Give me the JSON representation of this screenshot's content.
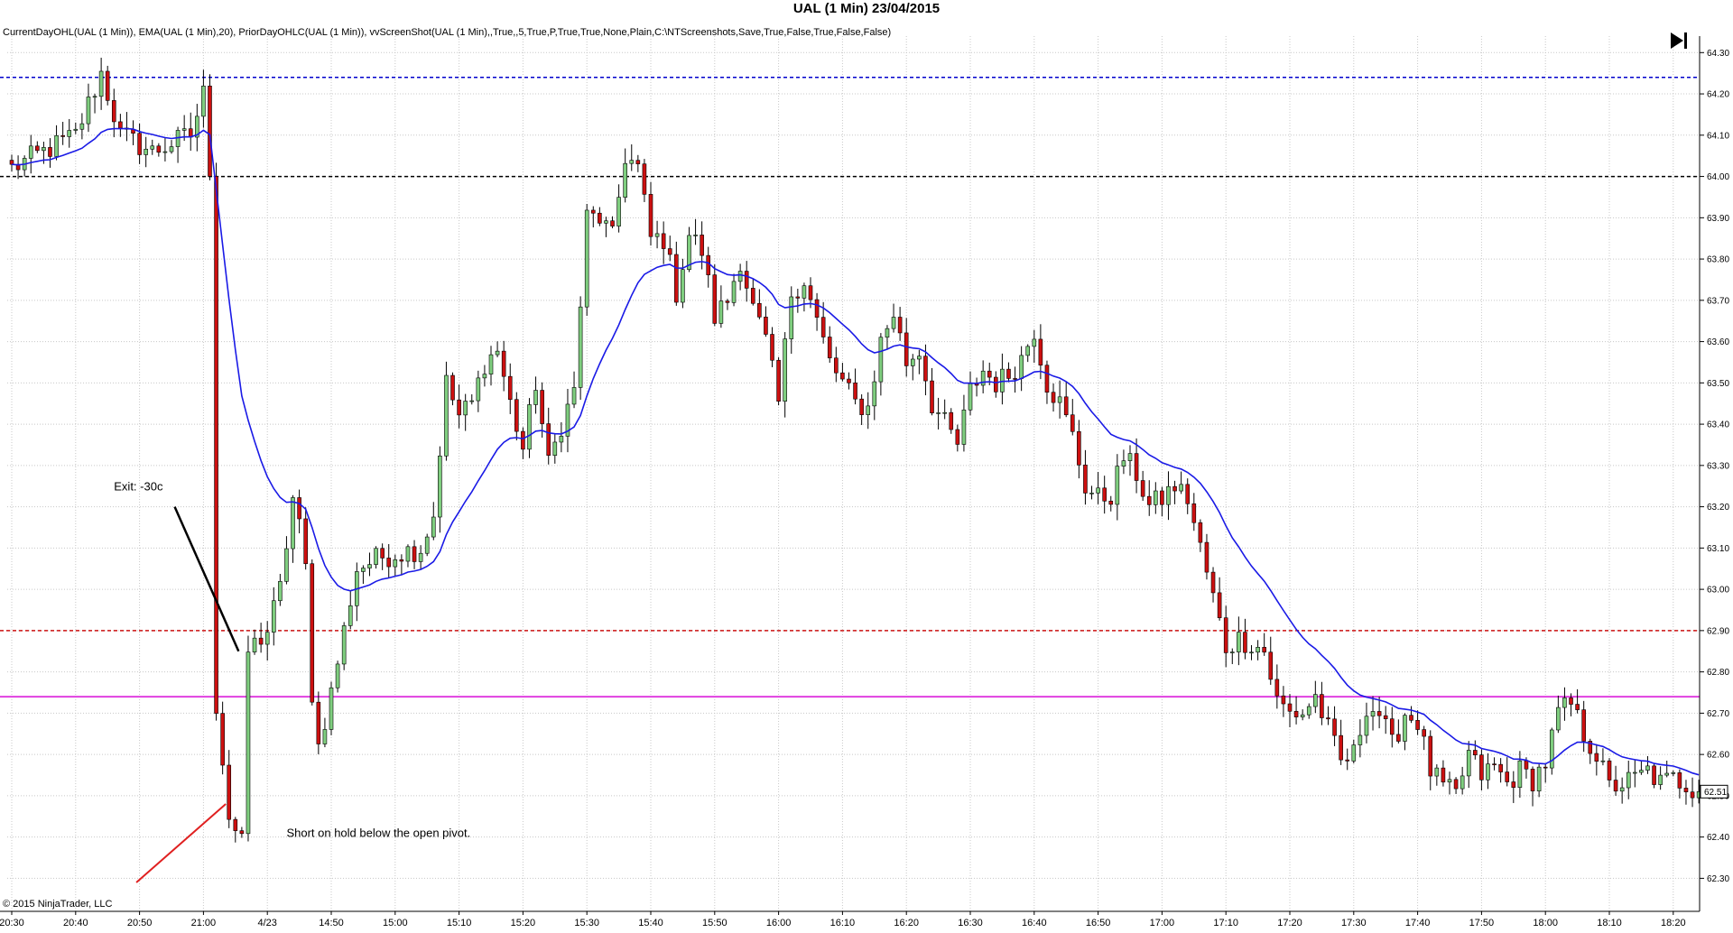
{
  "window": {
    "title": "UAL (1 Min)  23/04/2015",
    "indicators": "CurrentDayOHL(UAL (1 Min)), EMA(UAL (1 Min),20), PriorDayOHLC(UAL (1 Min)), vvScreenShot(UAL (1 Min),,True,,5,True,P,True,True,None,Plain,C:\\NTScreenshots,Save,True,False,True,False,False)",
    "copyright": "© 2015 NinjaTrader, LLC",
    "play_icon": "skip-to-end-icon"
  },
  "colors": {
    "up_candle": "#7fce7f",
    "down_candle": "#cc1010",
    "ema": "#1a1ae6",
    "prior_high": "#0000cc",
    "prior_close": "#000000",
    "day_open": "#cc1010",
    "pivot": "#e040e0",
    "exit_line": "#000000",
    "entry_arrow": "#e02020"
  },
  "chart_data": {
    "type": "candlestick",
    "title": "UAL (1 Min)  23/04/2015",
    "ylim": [
      62.22,
      64.34
    ],
    "yticks": [
      "64.30",
      "64.20",
      "64.10",
      "64.00",
      "63.90",
      "63.80",
      "63.70",
      "63.60",
      "63.50",
      "63.40",
      "63.30",
      "63.20",
      "63.10",
      "63.00",
      "62.90",
      "62.80",
      "62.70",
      "62.60",
      "62.50",
      "62.40",
      "62.30"
    ],
    "xticks": [
      "20:30",
      "20:40",
      "20:50",
      "21:00",
      "4/23",
      "14:50",
      "15:00",
      "15:10",
      "15:20",
      "15:30",
      "15:40",
      "15:50",
      "16:00",
      "16:10",
      "16:20",
      "16:30",
      "16:40",
      "16:50",
      "17:00",
      "17:10",
      "17:20",
      "17:30",
      "17:40",
      "17:50",
      "18:00",
      "18:10",
      "18:20"
    ],
    "bar_count": 265,
    "last_price": "62.51",
    "levels": [
      {
        "role": "prior_high",
        "value": 64.24,
        "style": "dashed"
      },
      {
        "role": "prior_close",
        "value": 64.0,
        "style": "dashed"
      },
      {
        "role": "day_open",
        "value": 62.9,
        "style": "dashed"
      },
      {
        "role": "pivot",
        "value": 62.74,
        "style": "solid"
      }
    ],
    "annotations": [
      {
        "text": "Exit: -30c",
        "bar": 16,
        "price": 63.24
      },
      {
        "text": "Short on hold below the open pivot.",
        "bar": 43,
        "price": 62.4
      }
    ],
    "exit_line": {
      "from": [
        25.5,
        63.2
      ],
      "to": [
        35.5,
        62.85
      ]
    },
    "entry_arrow": {
      "from": [
        19.5,
        62.29
      ],
      "to": [
        33.5,
        62.48
      ]
    },
    "grid": true,
    "keypoints": [
      [
        0,
        64.02
      ],
      [
        5,
        64.06
      ],
      [
        10,
        64.1
      ],
      [
        14,
        64.25
      ],
      [
        17,
        64.1
      ],
      [
        22,
        64.06
      ],
      [
        28,
        64.1
      ],
      [
        30,
        64.2
      ],
      [
        31,
        64.02
      ],
      [
        32,
        62.72
      ],
      [
        34,
        62.45
      ],
      [
        36,
        62.38
      ],
      [
        37,
        62.85
      ],
      [
        40,
        62.9
      ],
      [
        42,
        63.0
      ],
      [
        44,
        63.22
      ],
      [
        45,
        63.15
      ],
      [
        46,
        63.05
      ],
      [
        47,
        62.75
      ],
      [
        48,
        62.62
      ],
      [
        50,
        62.75
      ],
      [
        52,
        62.9
      ],
      [
        54,
        63.05
      ],
      [
        58,
        63.08
      ],
      [
        64,
        63.1
      ],
      [
        66,
        63.18
      ],
      [
        68,
        63.5
      ],
      [
        70,
        63.42
      ],
      [
        72,
        63.45
      ],
      [
        74,
        63.55
      ],
      [
        76,
        63.58
      ],
      [
        78,
        63.45
      ],
      [
        80,
        63.34
      ],
      [
        82,
        63.5
      ],
      [
        84,
        63.3
      ],
      [
        86,
        63.4
      ],
      [
        88,
        63.48
      ],
      [
        90,
        63.9
      ],
      [
        92,
        63.9
      ],
      [
        94,
        63.85
      ],
      [
        96,
        64.05
      ],
      [
        98,
        64.02
      ],
      [
        100,
        63.85
      ],
      [
        102,
        63.85
      ],
      [
        104,
        63.72
      ],
      [
        106,
        63.86
      ],
      [
        108,
        63.82
      ],
      [
        110,
        63.66
      ],
      [
        112,
        63.7
      ],
      [
        114,
        63.8
      ],
      [
        116,
        63.68
      ],
      [
        118,
        63.6
      ],
      [
        120,
        63.45
      ],
      [
        122,
        63.72
      ],
      [
        124,
        63.75
      ],
      [
        126,
        63.65
      ],
      [
        128,
        63.55
      ],
      [
        130,
        63.5
      ],
      [
        132,
        63.45
      ],
      [
        134,
        63.44
      ],
      [
        136,
        63.6
      ],
      [
        138,
        63.67
      ],
      [
        140,
        63.55
      ],
      [
        142,
        63.58
      ],
      [
        144,
        63.45
      ],
      [
        146,
        63.4
      ],
      [
        148,
        63.35
      ],
      [
        150,
        63.48
      ],
      [
        152,
        63.53
      ],
      [
        154,
        63.5
      ],
      [
        156,
        63.52
      ],
      [
        158,
        63.56
      ],
      [
        160,
        63.63
      ],
      [
        162,
        63.5
      ],
      [
        164,
        63.45
      ],
      [
        166,
        63.37
      ],
      [
        168,
        63.25
      ],
      [
        170,
        63.22
      ],
      [
        172,
        63.23
      ],
      [
        174,
        63.32
      ],
      [
        176,
        63.28
      ],
      [
        178,
        63.2
      ],
      [
        180,
        63.22
      ],
      [
        182,
        63.25
      ],
      [
        184,
        63.22
      ],
      [
        186,
        63.1
      ],
      [
        188,
        62.98
      ],
      [
        190,
        62.86
      ],
      [
        192,
        62.88
      ],
      [
        194,
        62.87
      ],
      [
        196,
        62.85
      ],
      [
        198,
        62.73
      ],
      [
        200,
        62.7
      ],
      [
        202,
        62.7
      ],
      [
        204,
        62.74
      ],
      [
        206,
        62.66
      ],
      [
        208,
        62.58
      ],
      [
        210,
        62.6
      ],
      [
        212,
        62.72
      ],
      [
        214,
        62.7
      ],
      [
        216,
        62.62
      ],
      [
        218,
        62.7
      ],
      [
        220,
        62.68
      ],
      [
        222,
        62.56
      ],
      [
        224,
        62.52
      ],
      [
        226,
        62.5
      ],
      [
        228,
        62.6
      ],
      [
        230,
        62.55
      ],
      [
        232,
        62.57
      ],
      [
        234,
        62.53
      ],
      [
        236,
        62.56
      ],
      [
        238,
        62.54
      ],
      [
        240,
        62.58
      ],
      [
        242,
        62.7
      ],
      [
        244,
        62.72
      ],
      [
        246,
        62.65
      ],
      [
        248,
        62.6
      ],
      [
        250,
        62.52
      ],
      [
        252,
        62.53
      ],
      [
        254,
        62.54
      ],
      [
        256,
        62.56
      ],
      [
        258,
        62.53
      ],
      [
        260,
        62.54
      ],
      [
        262,
        62.53
      ],
      [
        264,
        62.51
      ]
    ]
  }
}
